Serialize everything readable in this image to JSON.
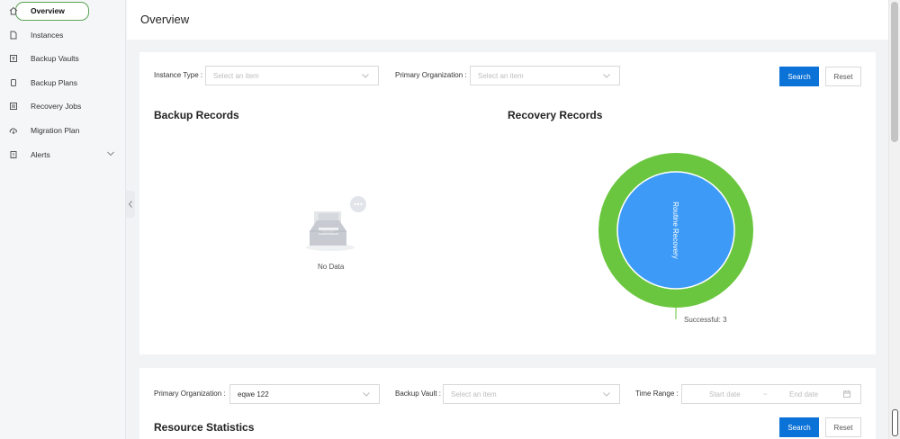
{
  "sidebar": {
    "items": [
      {
        "label": "Overview",
        "icon": "home-icon",
        "active": true
      },
      {
        "label": "Instances",
        "icon": "file-icon"
      },
      {
        "label": "Backup Vaults",
        "icon": "vault-icon"
      },
      {
        "label": "Backup Plans",
        "icon": "plan-icon"
      },
      {
        "label": "Recovery Jobs",
        "icon": "jobs-icon"
      },
      {
        "label": "Migration Plan",
        "icon": "cloud-icon"
      },
      {
        "label": "Alerts",
        "icon": "alert-icon",
        "has_children": true
      }
    ]
  },
  "header": {
    "title": "Overview"
  },
  "filters1": {
    "instance_type_label": "Instance Type :",
    "instance_type_placeholder": "Select an item",
    "primary_org_label": "Primary Organization :",
    "primary_org_placeholder": "Select an item",
    "search_label": "Search",
    "reset_label": "Reset"
  },
  "backup_records": {
    "title": "Backup Records",
    "empty_text": "No Data"
  },
  "recovery_records": {
    "title": "Recovery Records",
    "chart_data": {
      "type": "pie",
      "rings": [
        {
          "name": "Routine Recovery",
          "level": "inner",
          "value": 3,
          "color": "#3d9bf7"
        },
        {
          "name": "Successful",
          "level": "outer",
          "value": 3,
          "color": "#6ac63e"
        }
      ],
      "annotation": "Successful: 3",
      "inner_label": "Routine Recovery"
    }
  },
  "filters2": {
    "primary_org_label": "Primary Organization :",
    "primary_org_value": "eqwe 122",
    "backup_vault_label": "Backup Vault :",
    "backup_vault_placeholder": "Select an item",
    "time_range_label": "Time Range :",
    "start_placeholder": "Start date",
    "range_separator": "~",
    "end_placeholder": "End date",
    "search_label": "Search",
    "reset_label": "Reset"
  },
  "resource_statistics": {
    "title": "Resource Statistics"
  },
  "colors": {
    "primary": "#0b72d8",
    "active_outline": "#5aa457"
  }
}
